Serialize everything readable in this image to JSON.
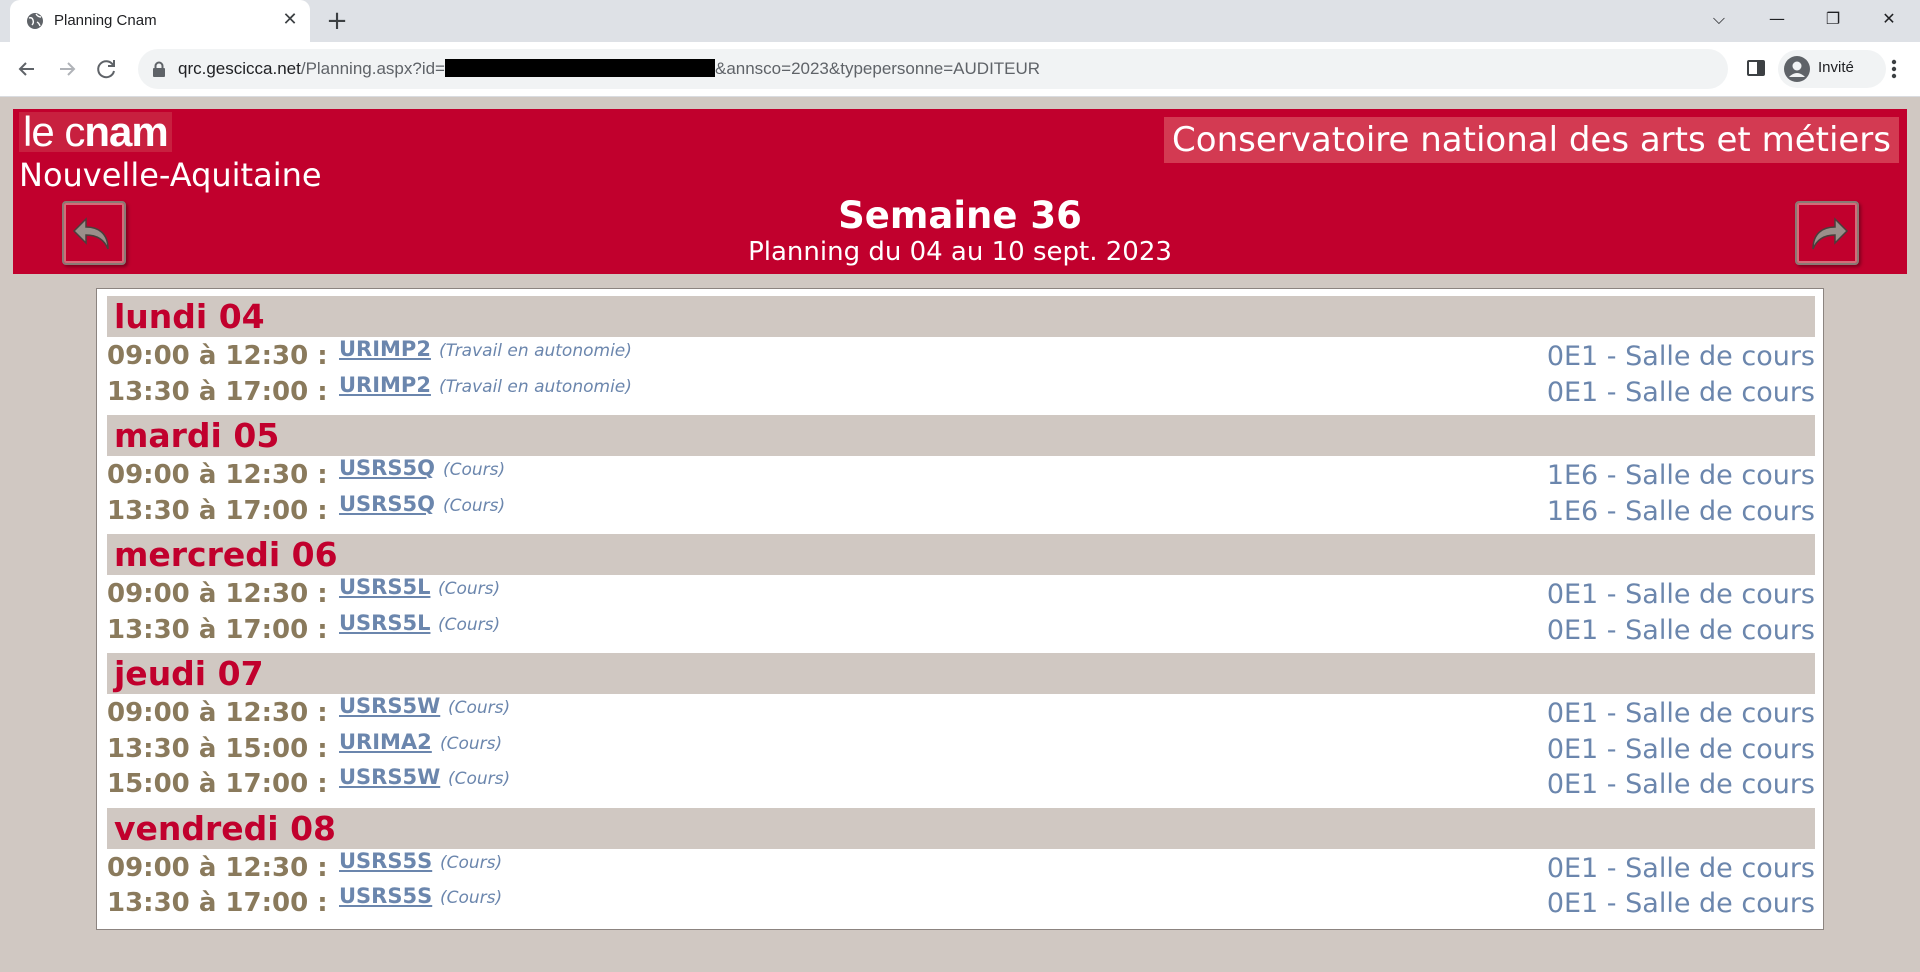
{
  "browser": {
    "tab_title": "Planning Cnam",
    "url_host": "qrc.gescicca.net",
    "url_path": "/Planning.aspx?id=",
    "url_query": "&annsco=2023&typepersonne=AUDITEUR",
    "profile_label": "Invité"
  },
  "header": {
    "logo_thin": "le c",
    "logo_bold": "nam",
    "region": "Nouvelle-Aquitaine",
    "institution": "Conservatoire national des arts et métiers",
    "week": "Semaine 36",
    "period": "Planning du 04 au 10 sept. 2023"
  },
  "days": [
    {
      "label": "lundi 04",
      "sessions": [
        {
          "time": "09:00 à 12:30 :",
          "code": "URIMP2",
          "type": "(Travail en autonomie)",
          "room": "0E1 - Salle de cours"
        },
        {
          "time": "13:30 à 17:00 :",
          "code": "URIMP2",
          "type": "(Travail en autonomie)",
          "room": "0E1 - Salle de cours"
        }
      ]
    },
    {
      "label": "mardi 05",
      "sessions": [
        {
          "time": "09:00 à 12:30 :",
          "code": "USRS5Q",
          "type": "(Cours)",
          "room": "1E6 - Salle de cours"
        },
        {
          "time": "13:30 à 17:00 :",
          "code": "USRS5Q",
          "type": "(Cours)",
          "room": "1E6 - Salle de cours"
        }
      ]
    },
    {
      "label": "mercredi 06",
      "sessions": [
        {
          "time": "09:00 à 12:30 :",
          "code": "USRS5L",
          "type": "(Cours)",
          "room": "0E1 - Salle de cours"
        },
        {
          "time": "13:30 à 17:00 :",
          "code": "USRS5L",
          "type": "(Cours)",
          "room": "0E1 - Salle de cours"
        }
      ]
    },
    {
      "label": "jeudi 07",
      "sessions": [
        {
          "time": "09:00 à 12:30 :",
          "code": "USRS5W",
          "type": "(Cours)",
          "room": "0E1 - Salle de cours"
        },
        {
          "time": "13:30 à 15:00 :",
          "code": "URIMA2",
          "type": "(Cours)",
          "room": "0E1 - Salle de cours"
        },
        {
          "time": "15:00 à 17:00 :",
          "code": "USRS5W",
          "type": "(Cours)",
          "room": "0E1 - Salle de cours"
        }
      ]
    },
    {
      "label": "vendredi 08",
      "sessions": [
        {
          "time": "09:00 à 12:30 :",
          "code": "USRS5S",
          "type": "(Cours)",
          "room": "0E1 - Salle de cours"
        },
        {
          "time": "13:30 à 17:00 :",
          "code": "USRS5S",
          "type": "(Cours)",
          "room": "0E1 - Salle de cours"
        }
      ]
    }
  ]
}
